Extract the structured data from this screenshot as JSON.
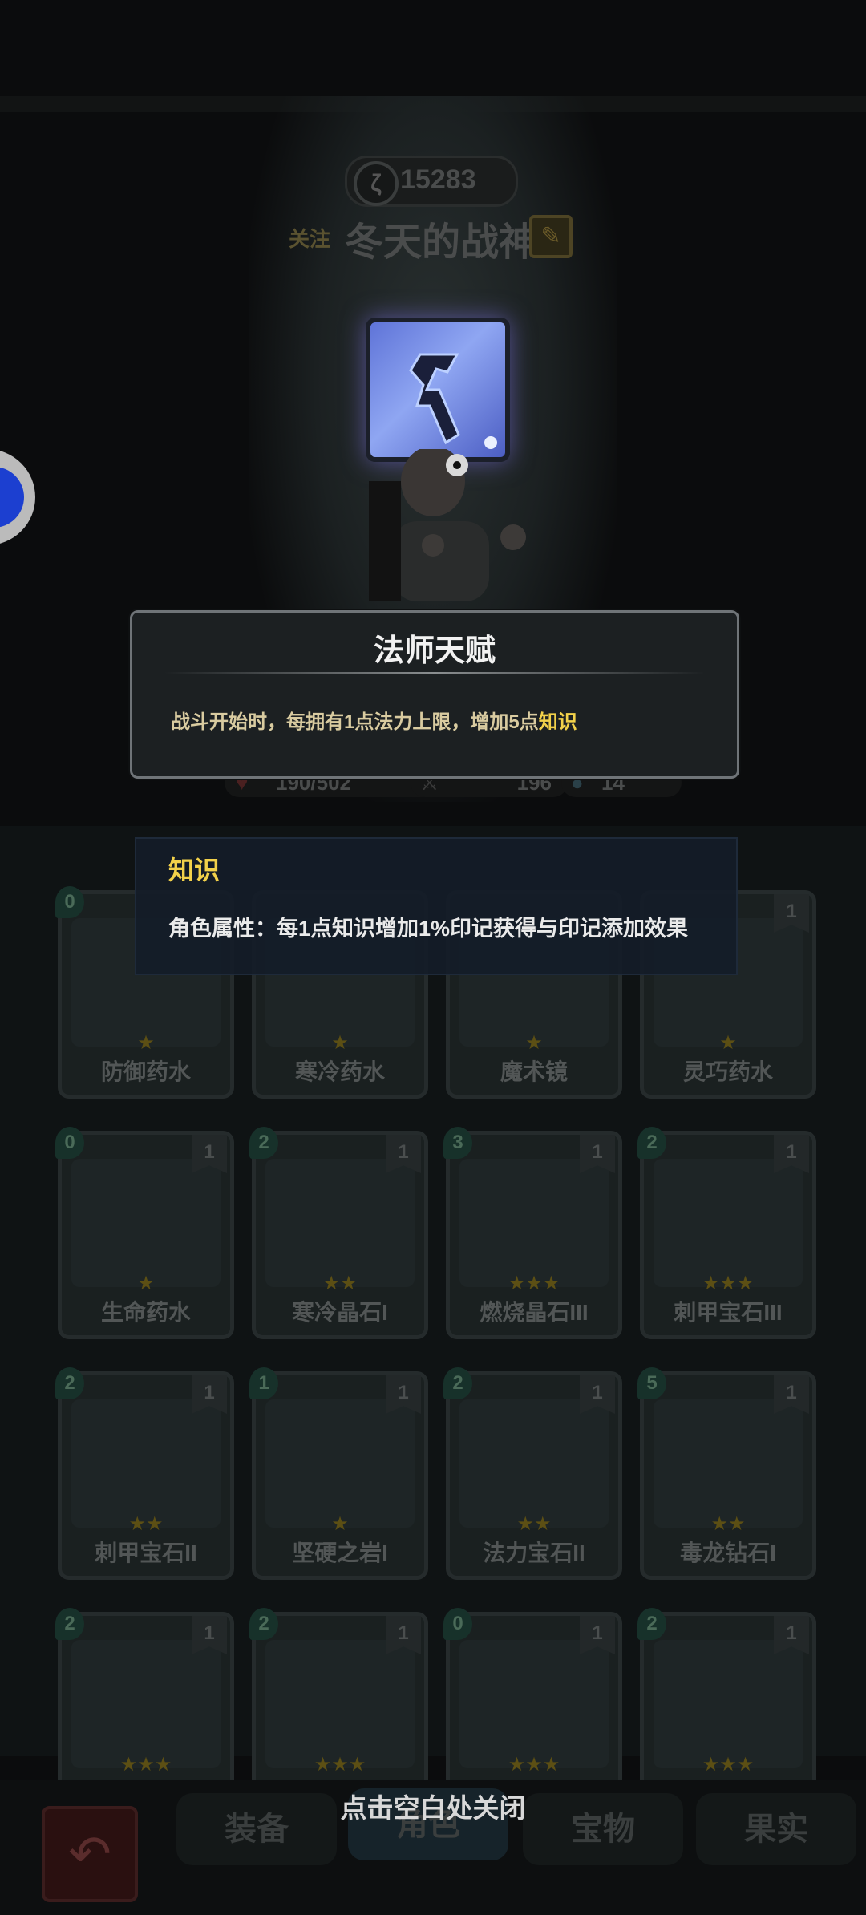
{
  "header": {
    "score": "15283",
    "follow_label": "关注",
    "player_name": "冬天的战神"
  },
  "stats": {
    "hp": "190/502",
    "attack": "196",
    "shield": "14"
  },
  "talent_popup": {
    "title": "法师天赋",
    "desc_prefix": "战斗开始时，每拥有1点法力上限，增加5点",
    "desc_keyword": "知识"
  },
  "keyword_popup": {
    "title": "知识",
    "desc": "角色属性：每1点知识增加1%印记获得与印记添加效果"
  },
  "cards": [
    {
      "name": "防御药水",
      "cost": "0",
      "stack": "",
      "stars": "★"
    },
    {
      "name": "寒冷药水",
      "cost": "",
      "stack": "",
      "stars": "★"
    },
    {
      "name": "魔术镜",
      "cost": "",
      "stack": "",
      "stars": "★"
    },
    {
      "name": "灵巧药水",
      "cost": "",
      "stack": "1",
      "stars": "★"
    },
    {
      "name": "生命药水",
      "cost": "0",
      "stack": "1",
      "stars": "★"
    },
    {
      "name": "寒冷晶石I",
      "cost": "2",
      "stack": "1",
      "stars": "★★"
    },
    {
      "name": "燃烧晶石III",
      "cost": "3",
      "stack": "1",
      "stars": "★★★"
    },
    {
      "name": "刺甲宝石III",
      "cost": "2",
      "stack": "1",
      "stars": "★★★"
    },
    {
      "name": "刺甲宝石II",
      "cost": "2",
      "stack": "1",
      "stars": "★★"
    },
    {
      "name": "坚硬之岩I",
      "cost": "1",
      "stack": "1",
      "stars": "★"
    },
    {
      "name": "法力宝石II",
      "cost": "2",
      "stack": "1",
      "stars": "★★"
    },
    {
      "name": "毒龙钻石I",
      "cost": "5",
      "stack": "1",
      "stars": "★★"
    },
    {
      "name": "",
      "cost": "2",
      "stack": "1",
      "stars": "★★★"
    },
    {
      "name": "",
      "cost": "2",
      "stack": "1",
      "stars": "★★★"
    },
    {
      "name": "",
      "cost": "0",
      "stack": "1",
      "stars": "★★★"
    },
    {
      "name": "",
      "cost": "2",
      "stack": "1",
      "stars": "★★★"
    }
  ],
  "tabs": [
    "装备",
    "角色",
    "宝物",
    "果实"
  ],
  "close_hint": "点击空白处关闭",
  "colors": {
    "keyword_yellow": "#f2d14a",
    "popup_border": "#6f7478",
    "skill_blue": "#6a80e0"
  }
}
